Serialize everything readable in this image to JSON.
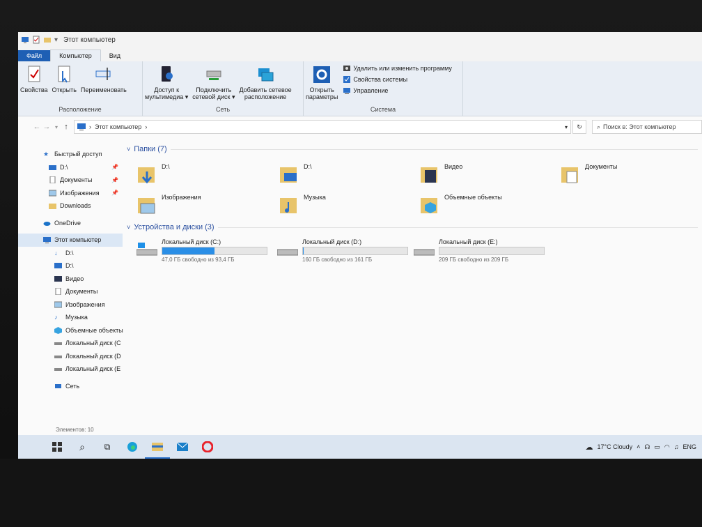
{
  "window": {
    "title": "Этот компьютер"
  },
  "tabs": [
    {
      "label": "Файл"
    },
    {
      "label": "Компьютер"
    },
    {
      "label": "Вид"
    }
  ],
  "ribbon": {
    "location": {
      "label": "Расположение",
      "properties": "Свойства",
      "open": "Открыть",
      "rename": "Переименовать"
    },
    "network": {
      "label": "Сеть",
      "media_access": "Доступ к\nмультимедиа ▾",
      "map_drive": "Подключить\nсетевой диск ▾",
      "add_location": "Добавить сетевое\nрасположение"
    },
    "system": {
      "label": "Система",
      "open_settings": "Открыть\nпараметры",
      "uninstall": "Удалить или изменить программу",
      "system_props": "Свойства системы",
      "manage": "Управление"
    }
  },
  "address": {
    "path": "Этот компьютер",
    "search_placeholder": "Поиск в: Этот компьютер"
  },
  "sidebar": {
    "items": [
      {
        "label": "Быстрый доступ",
        "pinned": false
      },
      {
        "label": "D:\\",
        "pinned": true
      },
      {
        "label": "Документы",
        "pinned": true
      },
      {
        "label": "Изображения",
        "pinned": true
      },
      {
        "label": "Downloads",
        "pinned": false
      },
      {
        "label": "OneDrive",
        "pinned": false
      },
      {
        "label": "Этот компьютер",
        "pinned": false
      },
      {
        "label": "D:\\",
        "pinned": false
      },
      {
        "label": "D:\\",
        "pinned": false
      },
      {
        "label": "Видео",
        "pinned": false
      },
      {
        "label": "Документы",
        "pinned": false
      },
      {
        "label": "Изображения",
        "pinned": false
      },
      {
        "label": "Музыка",
        "pinned": false
      },
      {
        "label": "Объемные объекты",
        "pinned": false
      },
      {
        "label": "Локальный диск (C",
        "pinned": false
      },
      {
        "label": "Локальный диск (D",
        "pinned": false
      },
      {
        "label": "Локальный диск (E",
        "pinned": false
      },
      {
        "label": "Сеть",
        "pinned": false
      }
    ]
  },
  "folders": {
    "header": "Папки (7)",
    "items": [
      {
        "label": "D:\\"
      },
      {
        "label": "D:\\"
      },
      {
        "label": "Видео"
      },
      {
        "label": "Документы"
      },
      {
        "label": "Изображения"
      },
      {
        "label": "Музыка"
      },
      {
        "label": "Объемные объекты"
      }
    ]
  },
  "drives": {
    "header": "Устройства и диски (3)",
    "items": [
      {
        "label": "Локальный диск (C:)",
        "free": "47,0 ГБ свободно из 93,4 ГБ",
        "used_fraction": 0.5
      },
      {
        "label": "Локальный диск (D:)",
        "free": "160 ГБ свободно из 161 ГБ",
        "used_fraction": 0.006
      },
      {
        "label": "Локальный диск (E:)",
        "free": "209 ГБ свободно из 209 ГБ",
        "used_fraction": 0.0
      }
    ]
  },
  "status": {
    "count": "Элементов: 10"
  },
  "taskbar": {
    "weather": "17°C  Cloudy",
    "language": "ENG"
  },
  "colors": {
    "accent": "#1e5fb4",
    "folder": "#e8c46a",
    "bar_fill": "#2a8ee6"
  }
}
